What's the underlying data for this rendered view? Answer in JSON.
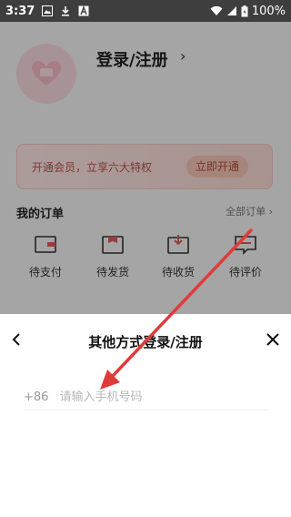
{
  "status_bar": {
    "time": "3:37",
    "battery": "100%",
    "icons": [
      "image-icon",
      "download-icon",
      "app-a-icon",
      "wifi-icon",
      "signal-icon",
      "battery-icon"
    ]
  },
  "profile": {
    "login_label": "登录/注册",
    "chevron": "›"
  },
  "vip_banner": {
    "text": "开通会员，立享六大特权",
    "button": "立即开通"
  },
  "orders": {
    "title": "我的订单",
    "all_link": "全部订单  ›",
    "items": [
      {
        "label": "待支付",
        "icon": "wallet-icon"
      },
      {
        "label": "待发货",
        "icon": "box-icon"
      },
      {
        "label": "待收货",
        "icon": "inbox-down-icon"
      },
      {
        "label": "待评价",
        "icon": "comment-icon"
      }
    ]
  },
  "sheet": {
    "title": "其他方式登录/注册",
    "country_code": "+86",
    "phone_placeholder": "请输入手机号码"
  },
  "colors": {
    "annotation_arrow": "#e03b3b",
    "accent": "#b4534a"
  }
}
